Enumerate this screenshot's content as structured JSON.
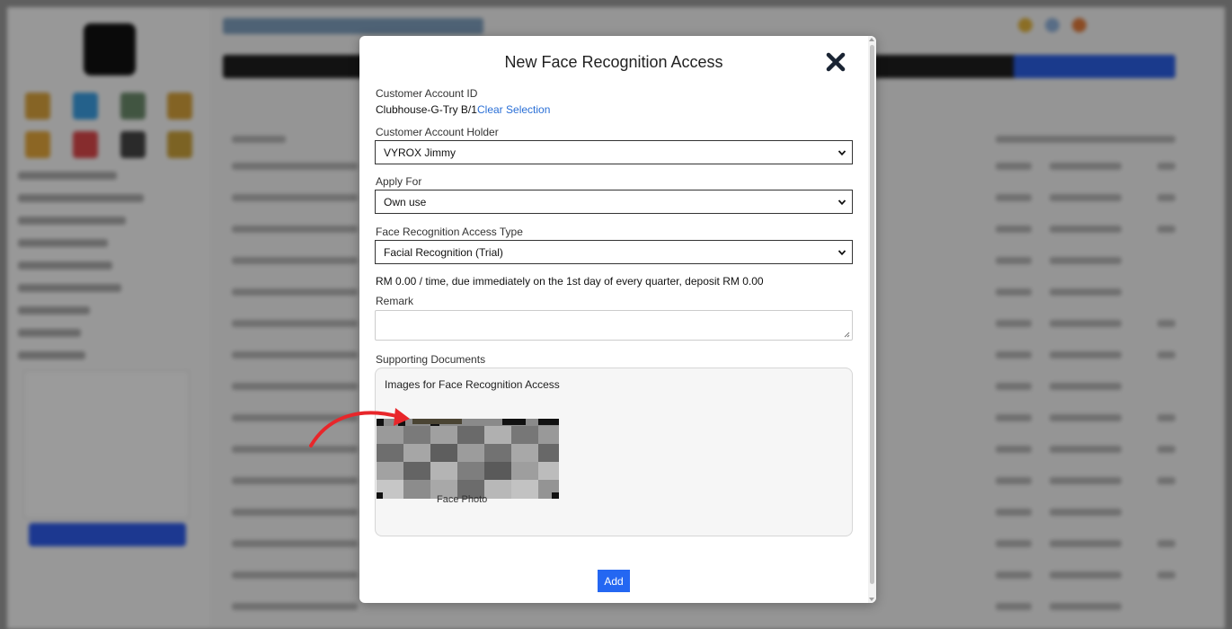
{
  "modal": {
    "title": "New Face Recognition Access",
    "customer_account_id": {
      "label": "Customer Account ID",
      "value": "Clubhouse-G-Try B/1",
      "clear_link": "Clear Selection"
    },
    "account_holder": {
      "label": "Customer Account Holder",
      "selected": "VYROX Jimmy"
    },
    "apply_for": {
      "label": "Apply For",
      "selected": "Own use"
    },
    "access_type": {
      "label": "Face Recognition Access Type",
      "selected": "Facial Recognition (Trial)"
    },
    "pricing_note": "RM 0.00 / time, due immediately on the 1st day of every quarter, deposit RM 0.00",
    "remark": {
      "label": "Remark",
      "value": ""
    },
    "supporting_documents": {
      "label": "Supporting Documents",
      "box_title": "Images for Face Recognition Access",
      "photo_caption": "Face Photo"
    },
    "add_button": "Add"
  },
  "icons": {
    "close": "close-icon",
    "select_chevron": "chevron-down-icon",
    "photo": "redacted-photo-icon",
    "annotation_arrow": "red-arrow-annotation"
  },
  "colors": {
    "primary_button": "#2467f2",
    "link": "#2a6fd6",
    "annotation": "#e8262a"
  }
}
